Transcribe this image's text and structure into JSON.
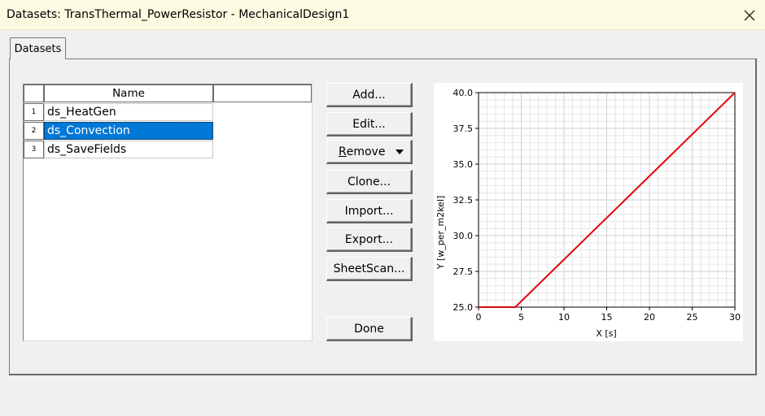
{
  "window": {
    "title": "Datasets: TransThermal_PowerResistor - MechanicalDesign1"
  },
  "tabs": [
    {
      "label": "Datasets"
    }
  ],
  "grid": {
    "column_header": "Name",
    "rows": [
      {
        "num": "1",
        "name": "ds_HeatGen",
        "selected": false
      },
      {
        "num": "2",
        "name": "ds_Convection",
        "selected": true
      },
      {
        "num": "3",
        "name": "ds_SaveFields",
        "selected": false
      }
    ]
  },
  "buttons": {
    "add": "Add...",
    "edit": "Edit...",
    "remove_mnemonic": "R",
    "remove_rest": "emove",
    "clone": "Clone...",
    "import": "Import...",
    "export": "Export...",
    "sheetscan": "SheetScan...",
    "done": "Done"
  },
  "icons": {
    "close": "close-icon",
    "remove_dropdown": "caret-down-icon"
  },
  "colors": {
    "selection": "#0078d7",
    "title_bar": "#fbfbe1",
    "series": "#e2070d"
  },
  "chart_data": {
    "type": "line",
    "title": "",
    "xlabel": "X [s]",
    "ylabel": "Y [w_per_m2kel]",
    "xlim": [
      0,
      30
    ],
    "ylim": [
      25,
      40
    ],
    "xticks": [
      0,
      5,
      10,
      15,
      20,
      25,
      30
    ],
    "yticks": [
      25.0,
      27.5,
      30.0,
      32.5,
      35.0,
      37.5,
      40.0
    ],
    "ytick_labels": [
      "25.0",
      "27.5",
      "30.0",
      "32.5",
      "35.0",
      "37.5",
      "40.0"
    ],
    "grid": true,
    "series": [
      {
        "x": [
          0,
          4.3,
          30
        ],
        "y": [
          25,
          25,
          40
        ]
      }
    ]
  }
}
